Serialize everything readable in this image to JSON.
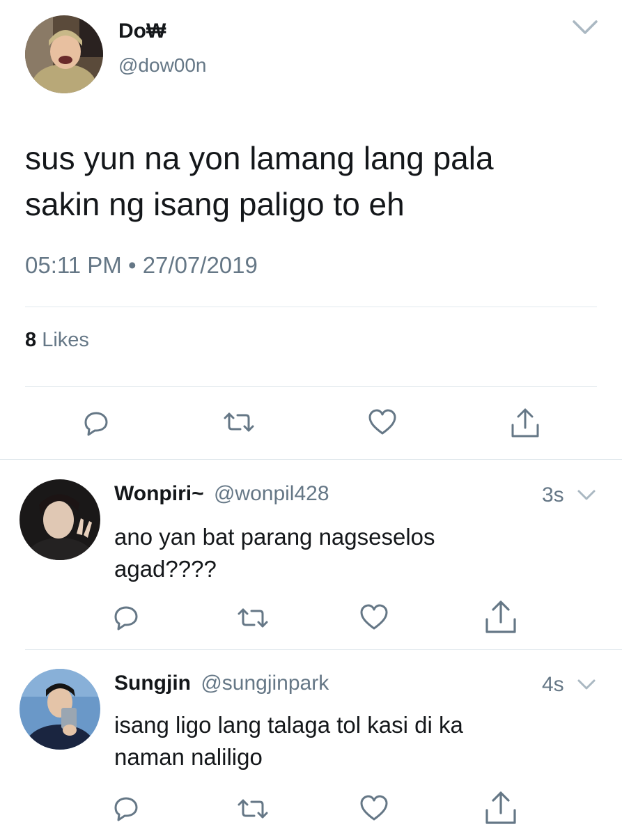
{
  "tweet": {
    "author_name": "Do₩",
    "author_handle": "@dow00n",
    "text_line1": "sus yun na yon lamang lang pala",
    "text_line2": "sakin ng isang paligo to eh",
    "timestamp": "05:11 PM • 27/07/2019",
    "likes_count": "8",
    "likes_label": "Likes"
  },
  "replies": [
    {
      "name": "Wonpiri~",
      "handle": "@wonpil428",
      "age": "3s",
      "line1": "ano yan bat parang nagseselos",
      "line2": "agad????"
    },
    {
      "name": "Sungjin",
      "handle": "@sungjinpark",
      "age": "4s",
      "line1": "isang ligo lang talaga tol kasi di ka",
      "line2": "naman naliligo"
    }
  ],
  "icons": {
    "reply": "reply-icon",
    "retweet": "retweet-icon",
    "like": "heart-icon",
    "share": "share-icon",
    "more": "chevron-down-icon"
  },
  "colors": {
    "text": "#14171a",
    "secondary": "#657786",
    "divider": "#e1e8ed"
  }
}
